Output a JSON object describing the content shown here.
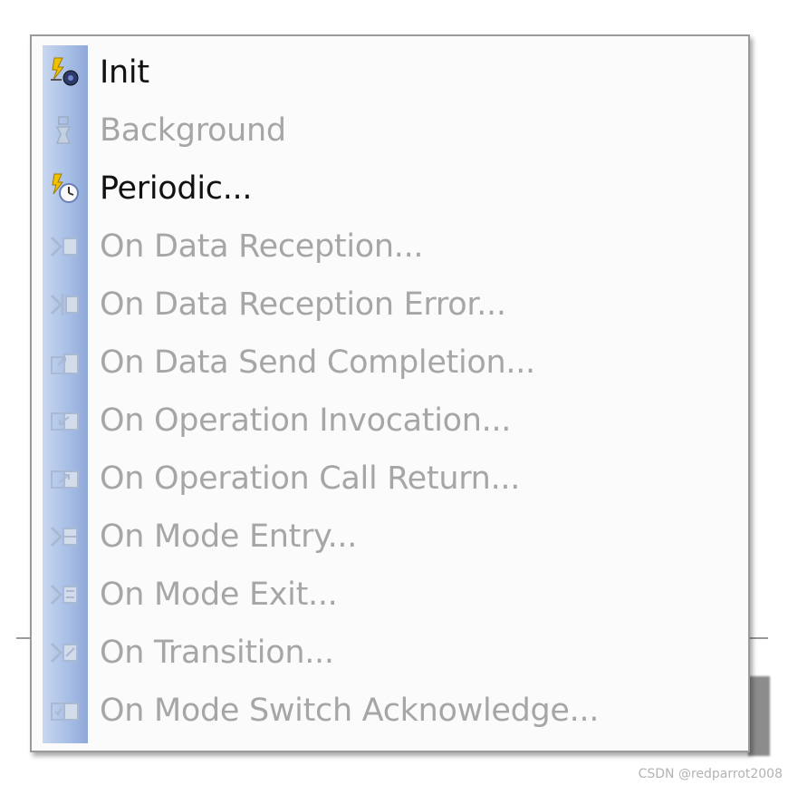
{
  "menu": {
    "items": [
      {
        "label": "Init",
        "enabled": true,
        "icon": "init-icon"
      },
      {
        "label": "Background",
        "enabled": false,
        "icon": "background-icon"
      },
      {
        "label": "Periodic...",
        "enabled": true,
        "icon": "periodic-icon"
      },
      {
        "label": "On Data Reception...",
        "enabled": false,
        "icon": "data-reception-icon"
      },
      {
        "label": "On Data Reception Error...",
        "enabled": false,
        "icon": "data-reception-error-icon"
      },
      {
        "label": "On Data Send Completion...",
        "enabled": false,
        "icon": "data-send-completion-icon"
      },
      {
        "label": "On Operation Invocation...",
        "enabled": false,
        "icon": "operation-invocation-icon"
      },
      {
        "label": "On Operation Call Return...",
        "enabled": false,
        "icon": "operation-call-return-icon"
      },
      {
        "label": "On Mode Entry...",
        "enabled": false,
        "icon": "mode-entry-icon"
      },
      {
        "label": "On Mode Exit...",
        "enabled": false,
        "icon": "mode-exit-icon"
      },
      {
        "label": "On Transition...",
        "enabled": false,
        "icon": "transition-icon"
      },
      {
        "label": "On Mode Switch Acknowledge...",
        "enabled": false,
        "icon": "mode-switch-acknowledge-icon"
      }
    ]
  },
  "watermark": "CSDN @redparrot2008",
  "colors": {
    "enabled_text": "#111111",
    "disabled_text": "#a6a6a6",
    "gutter": "#a8bfe6",
    "menu_background": "#fbfbfb"
  }
}
